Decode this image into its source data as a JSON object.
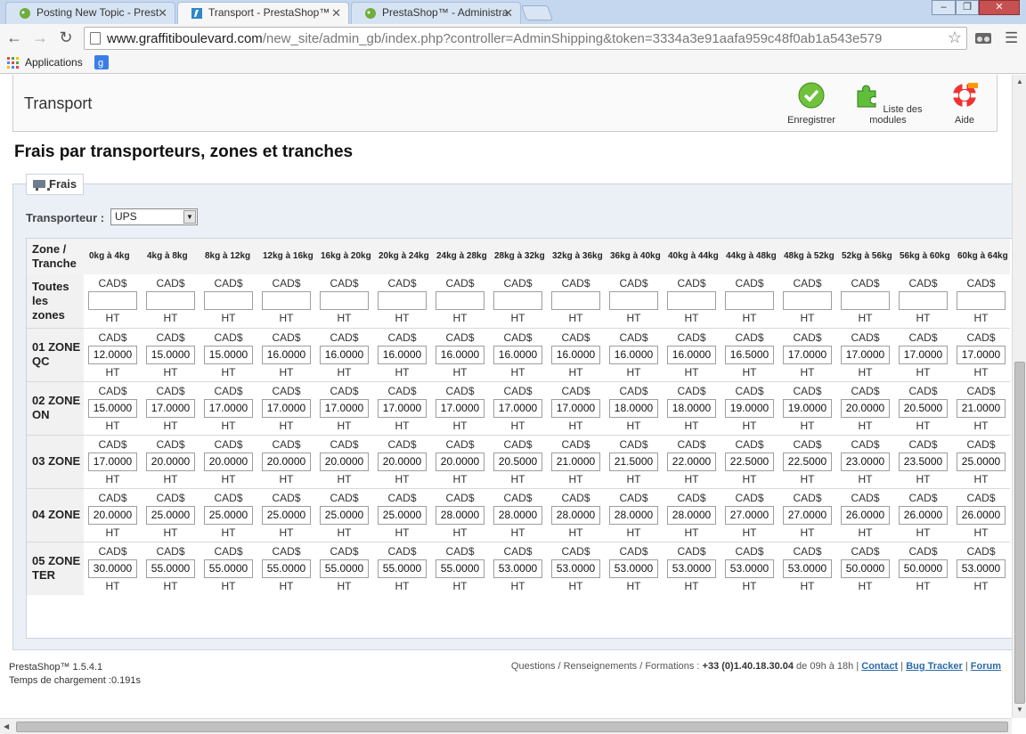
{
  "browser": {
    "tabs": [
      {
        "title": "Posting New Topic - Prest",
        "active": false
      },
      {
        "title": "Transport - PrestaShop™",
        "active": true
      },
      {
        "title": "PrestaShop™ - Administra",
        "active": false
      }
    ],
    "window_buttons": [
      "‒",
      "❐",
      "✕"
    ],
    "url_host": "www.graffitiboulevard.com",
    "url_path": "/new_site/admin_gb/index.php?controller=AdminShipping&token=3334a3e91aafa959c48f0ab1a543e579",
    "bookmarks": {
      "apps_label": "Applications"
    }
  },
  "toolbar": {
    "title": "Transport",
    "buttons": [
      {
        "label": "Enregistrer",
        "icon": "check-icon"
      },
      {
        "label": "Liste des modules",
        "icon": "puzzle-icon"
      },
      {
        "label": "Aide",
        "icon": "lifebuoy-icon"
      }
    ]
  },
  "heading": "Frais par transporteurs, zones et tranches",
  "fieldset": {
    "legend": "Frais",
    "carrier_label": "Transporteur :",
    "carrier_value": "UPS"
  },
  "table": {
    "zone_header": "Zone / Tranche",
    "currency": "CAD$",
    "tax": "HT",
    "ranges": [
      "0kg à 4kg",
      "4kg à 8kg",
      "8kg à 12kg",
      "12kg à 16kg",
      "16kg à 20kg",
      "20kg à 24kg",
      "24kg à 28kg",
      "28kg à 32kg",
      "32kg à 36kg",
      "36kg à 40kg",
      "40kg à 44kg",
      "44kg à 48kg",
      "48kg à 52kg",
      "52kg à 56kg",
      "56kg à 60kg",
      "60kg à 64kg"
    ],
    "rows": [
      {
        "zone": "Toutes les zones",
        "values": [
          "",
          "",
          "",
          "",
          "",
          "",
          "",
          "",
          "",
          "",
          "",
          "",
          "",
          "",
          "",
          ""
        ]
      },
      {
        "zone": "01 ZONE QC",
        "values": [
          "12.0000",
          "15.0000",
          "15.0000",
          "16.0000",
          "16.0000",
          "16.0000",
          "16.0000",
          "16.0000",
          "16.0000",
          "16.0000",
          "16.0000",
          "16.5000",
          "17.0000",
          "17.0000",
          "17.0000",
          "17.0000"
        ]
      },
      {
        "zone": "02 ZONE ON",
        "values": [
          "15.0000",
          "17.0000",
          "17.0000",
          "17.0000",
          "17.0000",
          "17.0000",
          "17.0000",
          "17.0000",
          "17.0000",
          "18.0000",
          "18.0000",
          "19.0000",
          "19.0000",
          "20.0000",
          "20.5000",
          "21.0000"
        ]
      },
      {
        "zone": "03 ZONE",
        "values": [
          "17.0000",
          "20.0000",
          "20.0000",
          "20.0000",
          "20.0000",
          "20.0000",
          "20.0000",
          "20.5000",
          "21.0000",
          "21.5000",
          "22.0000",
          "22.5000",
          "22.5000",
          "23.0000",
          "23.5000",
          "25.0000"
        ]
      },
      {
        "zone": "04 ZONE",
        "values": [
          "20.0000",
          "25.0000",
          "25.0000",
          "25.0000",
          "25.0000",
          "25.0000",
          "28.0000",
          "28.0000",
          "28.0000",
          "28.0000",
          "28.0000",
          "27.0000",
          "27.0000",
          "26.0000",
          "26.0000",
          "26.0000"
        ]
      },
      {
        "zone": "05 ZONE TER",
        "values": [
          "30.0000",
          "55.0000",
          "55.0000",
          "55.0000",
          "55.0000",
          "55.0000",
          "55.0000",
          "53.0000",
          "53.0000",
          "53.0000",
          "53.0000",
          "53.0000",
          "53.0000",
          "50.0000",
          "50.0000",
          "53.0000"
        ]
      }
    ]
  },
  "footer": {
    "version": "PrestaShop™ 1.5.4.1",
    "load_time": "Temps de chargement :0.191s",
    "contact_prefix": "Questions / Renseignements / Formations : ",
    "phone": "+33 (0)1.40.18.30.04",
    "hours": " de 09h à 18h | ",
    "links": [
      "Contact",
      "Bug Tracker",
      "Forum"
    ]
  }
}
